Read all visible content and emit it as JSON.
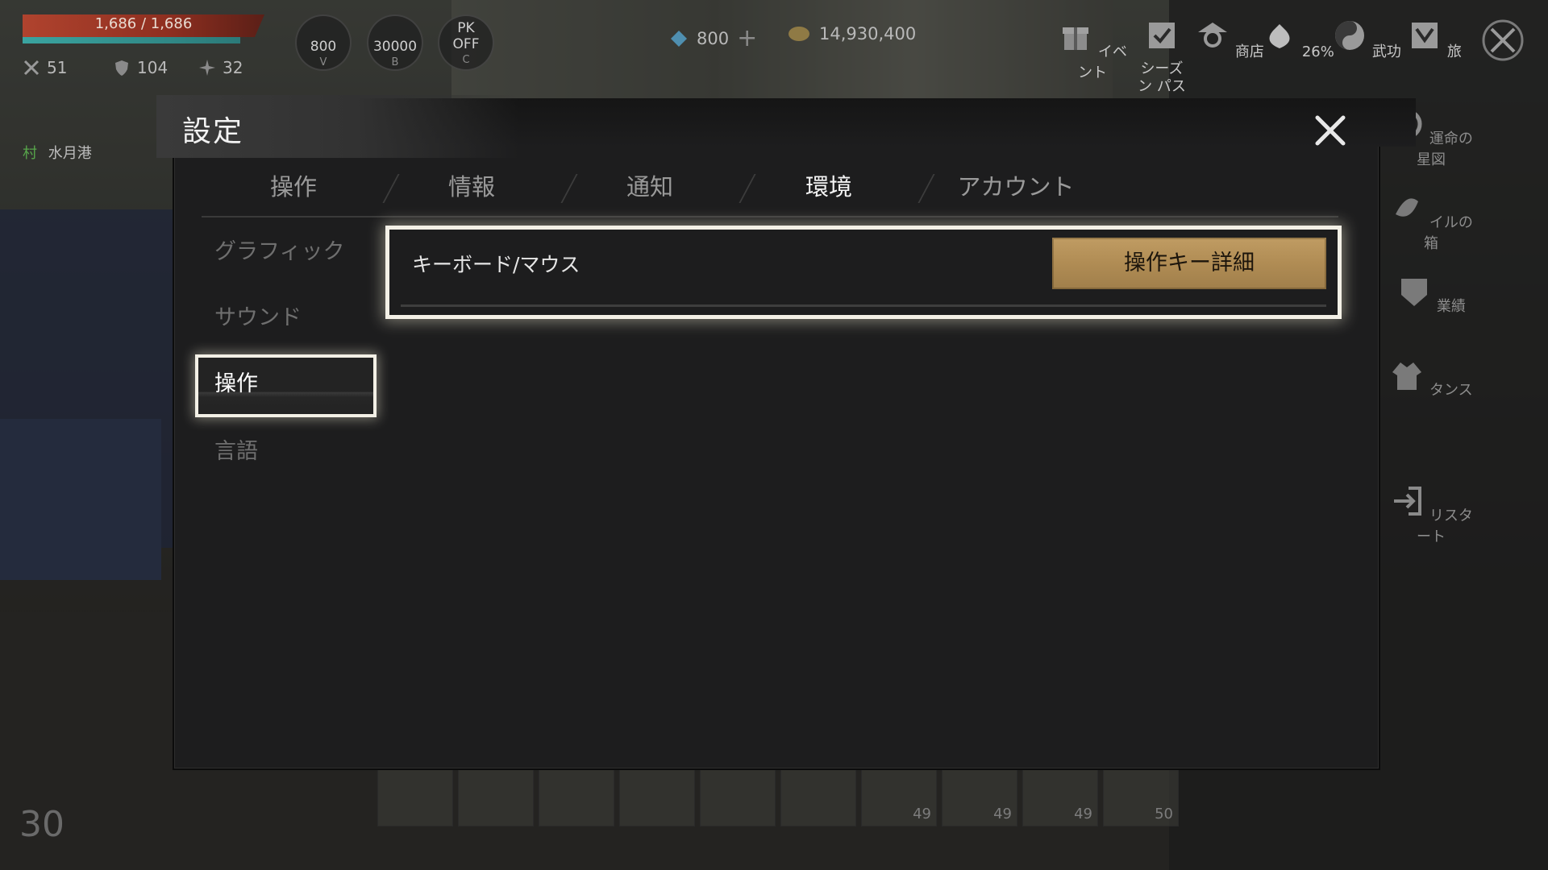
{
  "hud": {
    "hp_text": "1,686 / 1,686",
    "attack": "51",
    "defense": "104",
    "star": "32",
    "potion_count": "800",
    "potion_key": "V",
    "gold_potion": "30000",
    "gold_potion_key": "B",
    "pk_label_top": "PK",
    "pk_label_bottom": "OFF",
    "pk_key": "C",
    "location_tag": "村",
    "location_name": "水月港",
    "diamonds": "800",
    "gold": "14,930,400"
  },
  "top_menu": [
    {
      "label": "イベント"
    },
    {
      "label": "シーズン パス"
    },
    {
      "label": "商店"
    },
    {
      "label": "26%"
    },
    {
      "label": "武功"
    },
    {
      "label": "旅"
    }
  ],
  "side_menu": [
    {
      "label": "運命の星図"
    },
    {
      "label": "イルの箱"
    },
    {
      "label": "業績"
    },
    {
      "label": "タンス"
    },
    {
      "label": "リスタート"
    }
  ],
  "dialog": {
    "title": "設定",
    "tabs": [
      {
        "label": "操作",
        "active": false
      },
      {
        "label": "情報",
        "active": false
      },
      {
        "label": "通知",
        "active": false
      },
      {
        "label": "環境",
        "active": true
      },
      {
        "label": "アカウント",
        "active": false
      }
    ],
    "side_items": [
      {
        "label": "グラフィック"
      },
      {
        "label": "サウンド"
      },
      {
        "label": "操作"
      },
      {
        "label": "言語"
      }
    ],
    "keyboard_row": {
      "label": "キーボード/マウス",
      "button_label": "操作キー詳細"
    }
  },
  "hotbar": {
    "slots": [
      "",
      "",
      "",
      "",
      "",
      "",
      "49",
      "49",
      "49",
      "50"
    ],
    "level": "30"
  },
  "colors": {
    "highlight": "#f3f0e6",
    "button_gold": "#b08c54",
    "dialog_bg": "#1d1d1e"
  }
}
